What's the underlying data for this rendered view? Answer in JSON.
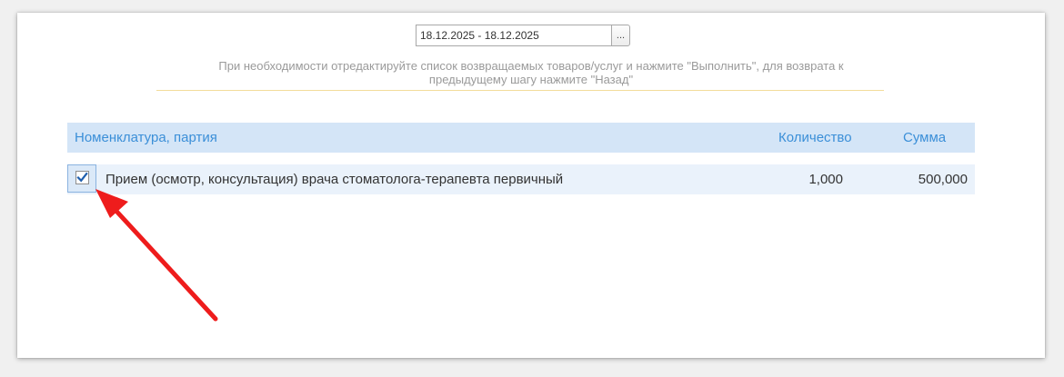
{
  "period": {
    "value": "18.12.2025 - 18.12.2025",
    "picker_label": "..."
  },
  "hint": {
    "line1": "При необходимости отредактируйте список возвращаемых товаров/услуг и нажмите \"Выполнить\", для возврата к",
    "line2": "предыдущему шагу нажмите \"Назад\""
  },
  "table": {
    "columns": {
      "name": "Номенклатура, партия",
      "quantity": "Количество",
      "sum": "Сумма"
    },
    "rows": [
      {
        "checked": true,
        "name": "Прием (осмотр, консультация) врача стоматолога-терапевта первичный",
        "quantity": "1,000",
        "sum": "500,000"
      }
    ]
  },
  "colors": {
    "header_bg": "#d4e5f7",
    "header_text": "#3b8fd8",
    "row_bg": "#eaf2fb",
    "annotation_arrow": "#ee1c1c",
    "checkmark": "#1f5fae"
  },
  "icons": {
    "checkbox": "checkmark-icon",
    "annotation": "red-arrow-icon"
  }
}
